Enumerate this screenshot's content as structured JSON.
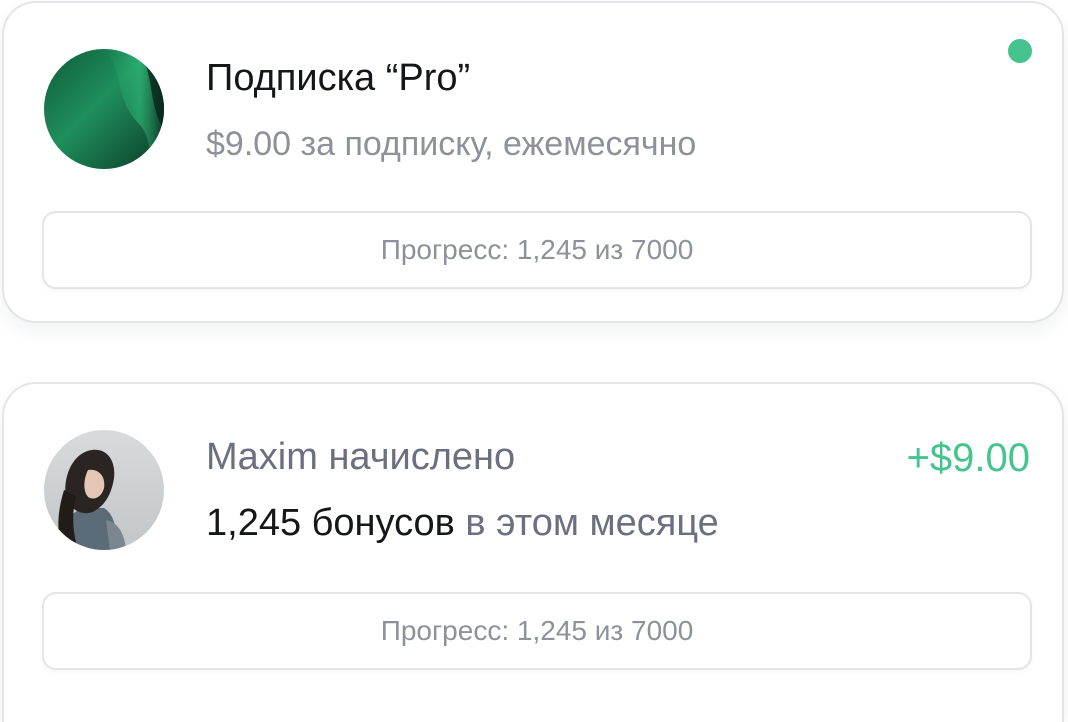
{
  "colors": {
    "accent_green": "#45c48f",
    "text_primary": "#14161a",
    "text_muted": "#8d919a",
    "border": "#e3e5e9"
  },
  "subscription_card": {
    "avatar_icon": "green-gradient-avatar",
    "title": "Подписка “Pro”",
    "subtitle": "$9.00 за подписку, ежемесячно",
    "status_icon": "online-status-dot",
    "progress_label": "Прогресс: 1,245 из 7000",
    "progress": {
      "current": 1245,
      "total": 7000
    }
  },
  "bonus_card": {
    "avatar_icon": "user-photo-avatar",
    "name_line": "Maxim начислено",
    "amount": "+$9.00",
    "bonus_count": "1,245 бонусов",
    "bonus_suffix": " в этом месяце",
    "progress_label": "Прогресс: 1,245 из 7000",
    "progress": {
      "current": 1245,
      "total": 7000
    }
  }
}
